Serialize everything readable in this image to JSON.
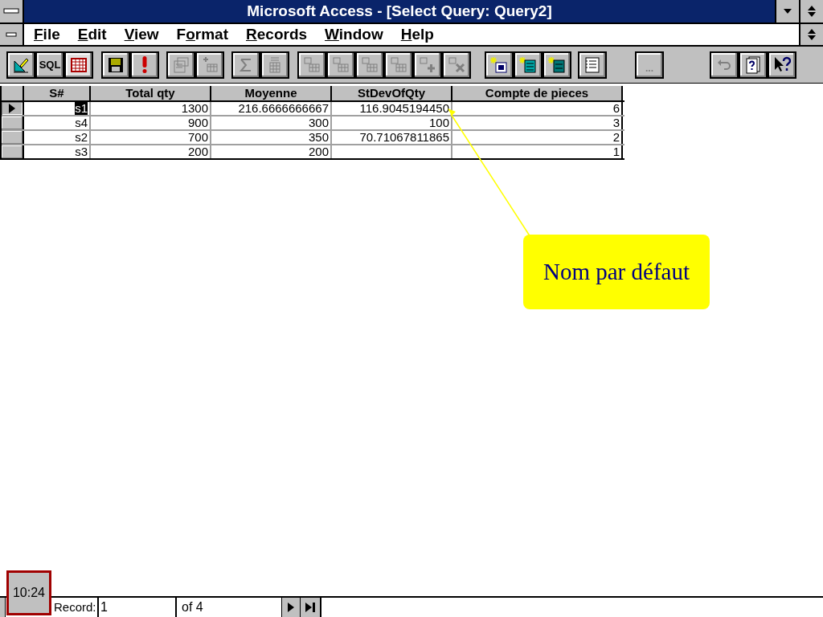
{
  "window": {
    "title": "Microsoft Access - [Select Query: Query2]"
  },
  "menu": [
    {
      "label": "File"
    },
    {
      "label": "Edit"
    },
    {
      "label": "View"
    },
    {
      "label": "Format"
    },
    {
      "label": "Records"
    },
    {
      "label": "Window"
    },
    {
      "label": "Help"
    }
  ],
  "toolbar": [
    [
      {
        "kind": "design",
        "disabled": false
      },
      {
        "kind": "sql",
        "label": "SQL",
        "disabled": false
      },
      {
        "kind": "datasheet",
        "disabled": false,
        "selected": true
      }
    ],
    [
      {
        "kind": "save",
        "disabled": false
      },
      {
        "kind": "run",
        "disabled": false
      }
    ],
    [
      {
        "kind": "properties",
        "disabled": true
      },
      {
        "kind": "addtable",
        "disabled": true
      }
    ],
    [
      {
        "kind": "totals",
        "disabled": true
      },
      {
        "kind": "build",
        "disabled": true
      }
    ],
    [
      {
        "kind": "qtable",
        "disabled": true
      },
      {
        "kind": "qtable",
        "disabled": true
      },
      {
        "kind": "qtable",
        "disabled": true
      },
      {
        "kind": "qtable",
        "disabled": true
      },
      {
        "kind": "qplus",
        "disabled": true
      },
      {
        "kind": "qdelete",
        "disabled": true
      }
    ],
    [
      {
        "kind": "newquery",
        "disabled": false
      },
      {
        "kind": "newform",
        "disabled": false
      },
      {
        "kind": "newreport",
        "disabled": false
      }
    ],
    [
      {
        "kind": "database",
        "disabled": false
      }
    ],
    [
      {
        "kind": "text",
        "label": "...",
        "disabled": true
      }
    ],
    [
      {
        "kind": "undo",
        "disabled": true
      },
      {
        "kind": "cuecards",
        "disabled": false
      },
      {
        "kind": "helpcursor",
        "disabled": false
      }
    ]
  ],
  "table": {
    "columns": [
      "S#",
      "Total qty",
      "Moyenne",
      "StDevOfQty",
      "Compte de pieces"
    ],
    "rows": [
      {
        "selected": true,
        "cells": [
          "s1",
          "1300",
          "216.6666666667",
          "116.9045194450",
          "6"
        ]
      },
      {
        "selected": false,
        "cells": [
          "s4",
          "900",
          "300",
          "100",
          "3"
        ]
      },
      {
        "selected": false,
        "cells": [
          "s2",
          "700",
          "350",
          "70.71067811865",
          "2"
        ]
      },
      {
        "selected": false,
        "cells": [
          "s3",
          "200",
          "200",
          "",
          "1"
        ]
      }
    ]
  },
  "callout": {
    "text": "Nom par défaut"
  },
  "navigation": {
    "label": "Record:",
    "current": "1",
    "total": "of  4"
  },
  "clock": "10:24"
}
